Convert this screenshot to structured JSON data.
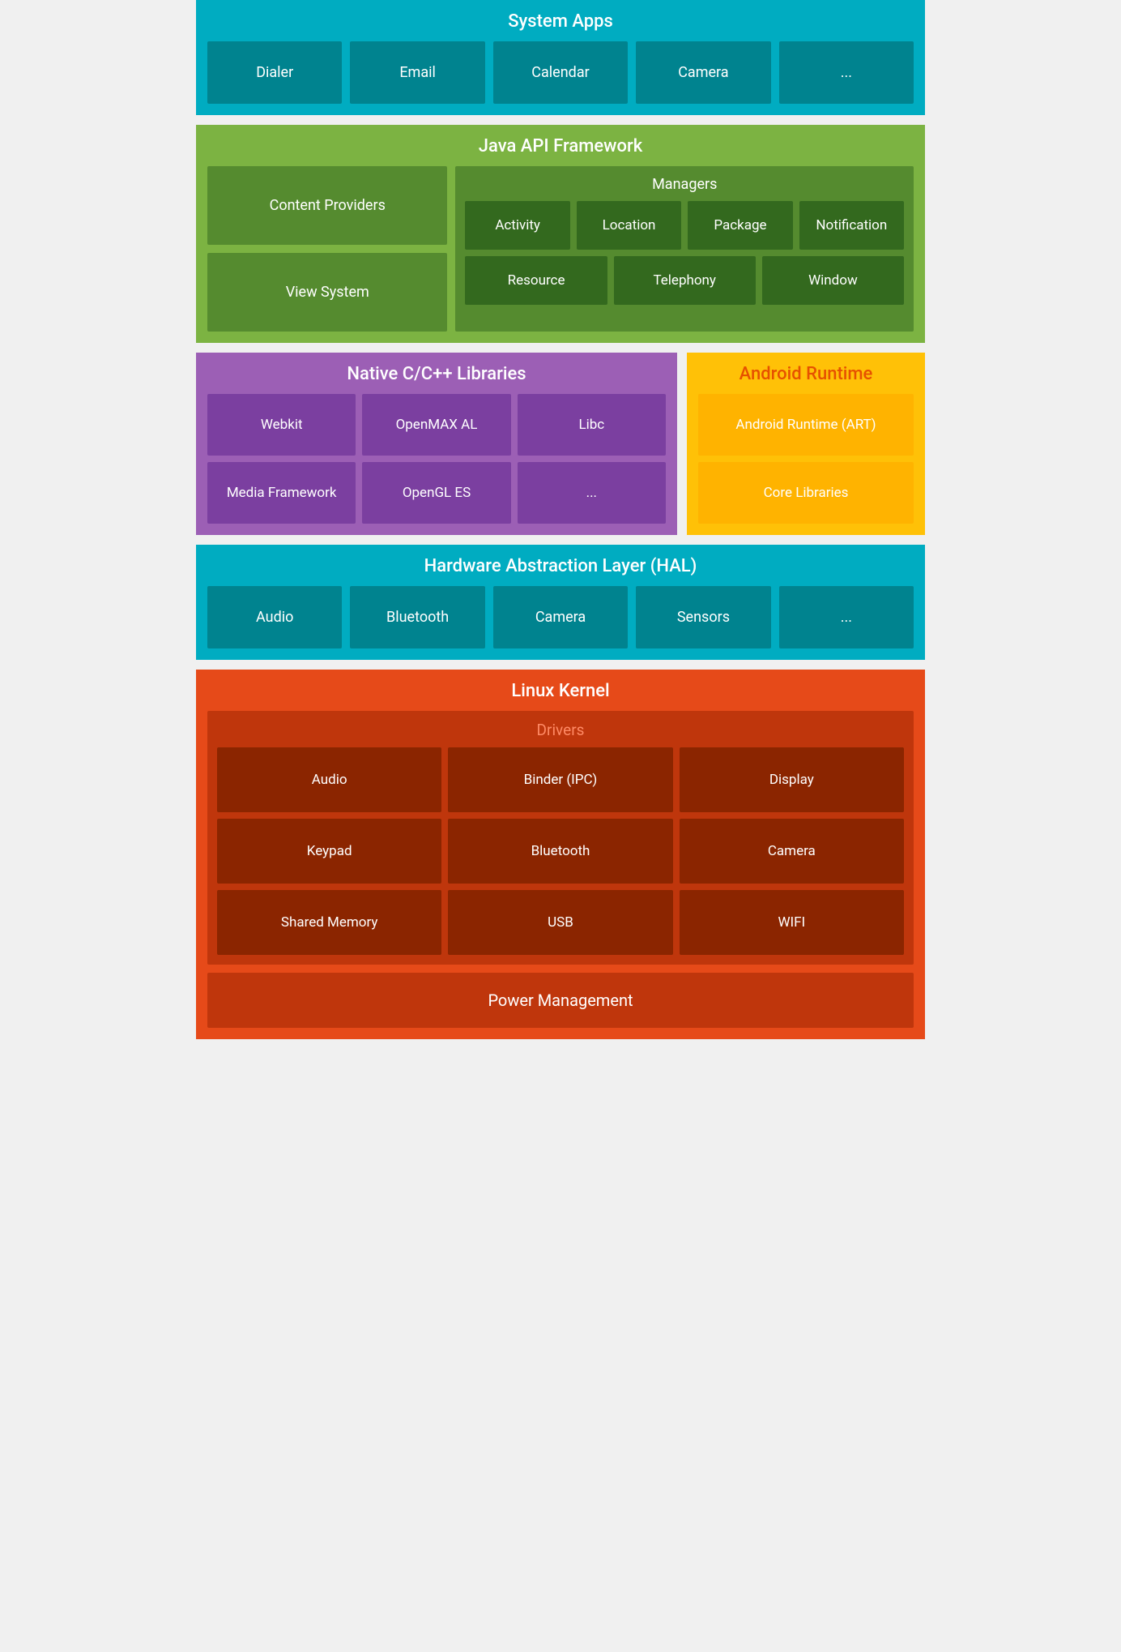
{
  "systemApps": {
    "title": "System Apps",
    "items": [
      "Dialer",
      "Email",
      "Calendar",
      "Camera",
      "..."
    ]
  },
  "javaApi": {
    "title": "Java API Framework",
    "contentProviders": "Content Providers",
    "viewSystem": "View System",
    "managers": {
      "title": "Managers",
      "row1": [
        "Activity",
        "Location",
        "Package",
        "Notification"
      ],
      "row2": [
        "Resource",
        "Telephony",
        "Window"
      ]
    }
  },
  "nativeLibs": {
    "title": "Native C/C++ Libraries",
    "row1": [
      "Webkit",
      "OpenMAX AL",
      "Libc"
    ],
    "row2": [
      "Media Framework",
      "OpenGL ES",
      "..."
    ]
  },
  "androidRuntime": {
    "title": "Android Runtime",
    "items": [
      "Android Runtime (ART)",
      "Core Libraries"
    ]
  },
  "hal": {
    "title": "Hardware Abstraction Layer (HAL)",
    "items": [
      "Audio",
      "Bluetooth",
      "Camera",
      "Sensors",
      "..."
    ]
  },
  "linuxKernel": {
    "title": "Linux Kernel",
    "driversTitle": "Drivers",
    "row1": [
      "Audio",
      "Binder (IPC)",
      "Display"
    ],
    "row2": [
      "Keypad",
      "Bluetooth",
      "Camera"
    ],
    "row3": [
      "Shared Memory",
      "USB",
      "WIFI"
    ],
    "powerManagement": "Power Management"
  }
}
